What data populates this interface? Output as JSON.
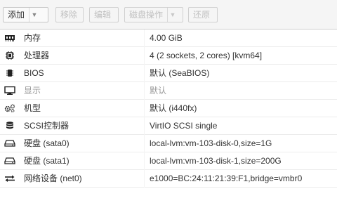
{
  "toolbar": {
    "add_label": "添加",
    "remove_label": "移除",
    "edit_label": "编辑",
    "disk_action_label": "磁盘操作",
    "revert_label": "还原"
  },
  "rows": [
    {
      "key": "内存",
      "value": "4.00 GiB",
      "icon": "memory-icon",
      "dim": false
    },
    {
      "key": "处理器",
      "value": "4 (2 sockets, 2 cores) [kvm64]",
      "icon": "cpu-icon",
      "dim": false
    },
    {
      "key": "BIOS",
      "value": "默认 (SeaBIOS)",
      "icon": "bios-chip-icon",
      "dim": false
    },
    {
      "key": "显示",
      "value": "默认",
      "icon": "monitor-icon",
      "dim": true
    },
    {
      "key": "机型",
      "value": "默认 (i440fx)",
      "icon": "cogs-icon",
      "dim": false
    },
    {
      "key": "SCSI控制器",
      "value": "VirtIO SCSI single",
      "icon": "database-icon",
      "dim": false
    },
    {
      "key": "硬盘 (sata0)",
      "value": "local-lvm:vm-103-disk-0,size=1G",
      "icon": "hdd-icon",
      "dim": false
    },
    {
      "key": "硬盘 (sata1)",
      "value": "local-lvm:vm-103-disk-1,size=200G",
      "icon": "hdd-icon",
      "dim": false
    },
    {
      "key": "网络设备 (net0)",
      "value": "e1000=BC:24:11:21:39:F1,bridge=vmbr0",
      "icon": "network-exchange-icon",
      "dim": false
    }
  ]
}
